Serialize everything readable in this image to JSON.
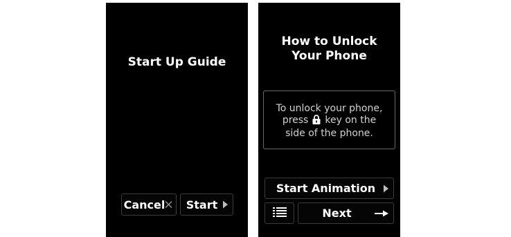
{
  "screen1": {
    "title": "Start Up Guide",
    "cancel_label": "Cancel",
    "start_label": "Start"
  },
  "screen2": {
    "title": "How to Unlock\nYour Phone",
    "instructions": {
      "line1": "To unlock your phone,",
      "line2_before": "press",
      "line2_after": "key on the",
      "line3": "side of the phone."
    },
    "start_animation_label": "Start Animation",
    "next_label": "Next"
  },
  "icons": {
    "cancel": "close-icon",
    "start": "play-arrow-icon",
    "lock": "lock-icon",
    "start_animation": "play-arrow-icon",
    "list": "list-icon",
    "next": "right-arrow-icon"
  },
  "colors": {
    "screen_background": "#000000",
    "text": "#ffffff",
    "button_border": "#3c3c3c",
    "info_text": "#d2d2d2"
  }
}
